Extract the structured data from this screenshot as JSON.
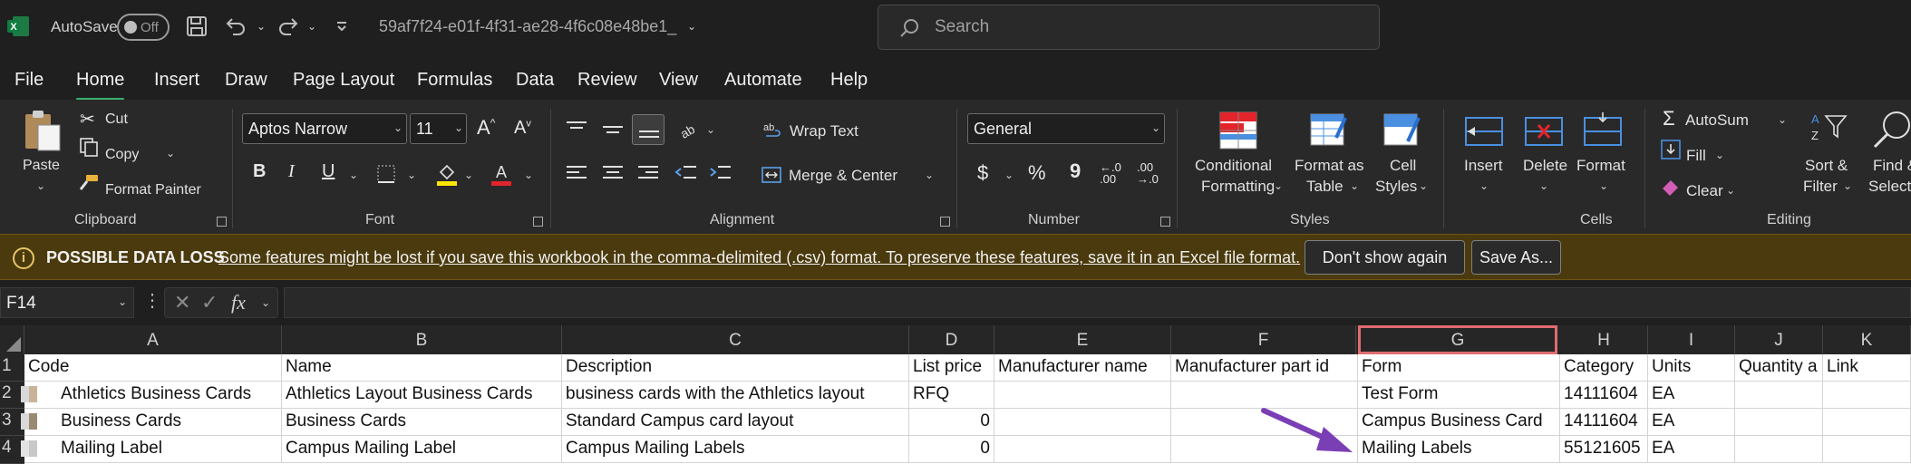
{
  "titlebar": {
    "autosave_label": "AutoSave",
    "toggle_state": "Off",
    "filename": "59af7f24-e01f-4f31-ae28-4f6c08e48be1_",
    "search_placeholder": "Search"
  },
  "menu": {
    "tabs": [
      "File",
      "Home",
      "Insert",
      "Draw",
      "Page Layout",
      "Formulas",
      "Data",
      "Review",
      "View",
      "Automate",
      "Help"
    ],
    "active": "Home"
  },
  "ribbon": {
    "clipboard": {
      "paste": "Paste",
      "cut": "Cut",
      "copy": "Copy",
      "format_painter": "Format Painter",
      "label": "Clipboard"
    },
    "font": {
      "family": "Aptos Narrow",
      "size": "11",
      "bold": "B",
      "italic": "I",
      "underline": "U",
      "label": "Font"
    },
    "alignment": {
      "wrap_text": "Wrap Text",
      "merge_center": "Merge & Center",
      "label": "Alignment"
    },
    "number": {
      "format": "General",
      "currency": "$",
      "percent": "%",
      "comma": "9",
      "label": "Number"
    },
    "styles": {
      "conditional": "Conditional",
      "formatting": "Formatting",
      "format_as": "Format as",
      "table": "Table",
      "cell": "Cell",
      "cell_styles": "Styles",
      "label": "Styles"
    },
    "cells": {
      "insert": "Insert",
      "delete": "Delete",
      "format": "Format",
      "label": "Cells"
    },
    "editing": {
      "autosum": "AutoSum",
      "fill": "Fill",
      "clear": "Clear",
      "sort": "Sort &",
      "filter": "Filter",
      "find": "Find &",
      "select": "Select",
      "label": "Editing"
    }
  },
  "infobar": {
    "title": "POSSIBLE DATA LOSS",
    "message": "Some features might be lost if you save this workbook in the comma-delimited (.csv) format. To preserve these features, save it in an Excel file format.",
    "dont_show": "Don't show again",
    "save_as": "Save As..."
  },
  "formula_bar": {
    "name_box": "F14",
    "fx": "fx",
    "value": ""
  },
  "grid": {
    "columns": [
      "A",
      "B",
      "C",
      "D",
      "E",
      "F",
      "G",
      "H",
      "I",
      "J",
      "K"
    ],
    "selected_column": "G",
    "row_numbers": [
      "1",
      "2",
      "3",
      "4"
    ],
    "rows": [
      [
        "Code",
        "Name",
        "Description",
        "List price",
        "Manufacturer name",
        "Manufacturer part id",
        "Form",
        "Category",
        "Units",
        "Quantity a",
        "Link"
      ],
      [
        "Athletics Business Cards",
        "Athletics Layout Business Cards",
        "business cards with the Athletics layout",
        "RFQ",
        "",
        "",
        "Test Form",
        "14111604",
        "EA",
        "",
        ""
      ],
      [
        "Business Cards",
        "Business Cards",
        "Standard Campus card layout",
        "0",
        "",
        "",
        "Campus Business Card",
        "14111604",
        "EA",
        "",
        ""
      ],
      [
        "Mailing Label",
        "Campus Mailing Label",
        "Campus Mailing Labels",
        "0",
        "",
        "",
        "Mailing Labels",
        "55121605",
        "EA",
        "",
        ""
      ]
    ],
    "annotation_color": "#7b3fb5"
  }
}
